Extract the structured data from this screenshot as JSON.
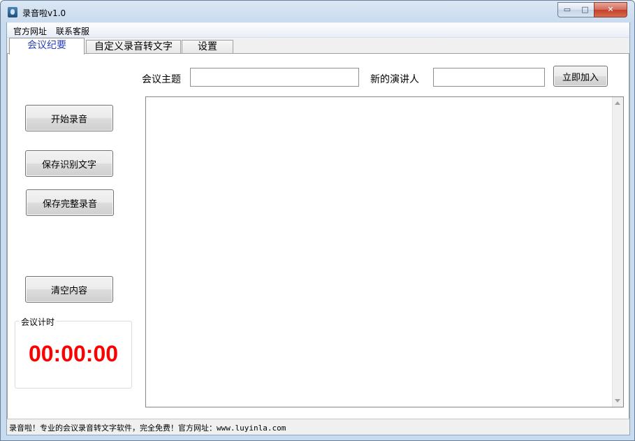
{
  "window": {
    "title": "录音啦v1.0",
    "controls": {
      "minimize": "▭",
      "maximize": "□",
      "close": "✕"
    }
  },
  "menu": {
    "items": [
      "官方网址",
      "联系客服"
    ]
  },
  "tabs": [
    {
      "label": "会议纪要",
      "active": true
    },
    {
      "label": "自定义录音转文字",
      "active": false
    },
    {
      "label": "设置",
      "active": false
    }
  ],
  "meeting": {
    "topic_label": "会议主题",
    "topic_value": "",
    "speaker_label": "新的演讲人",
    "speaker_value": "",
    "join_button": "立即加入"
  },
  "sidebar": {
    "start_button": "开始录音",
    "save_text_button": "保存识别文字",
    "save_audio_button": "保存完整录音",
    "clear_button": "清空内容"
  },
  "timer": {
    "group_title": "会议计时",
    "value": "00:00:00",
    "color": "#ff0000"
  },
  "transcript": {
    "content": ""
  },
  "status": {
    "text": "录音啦！专业的会议录音转文字软件，完全免费！官方网址：www.luyinla.com"
  }
}
